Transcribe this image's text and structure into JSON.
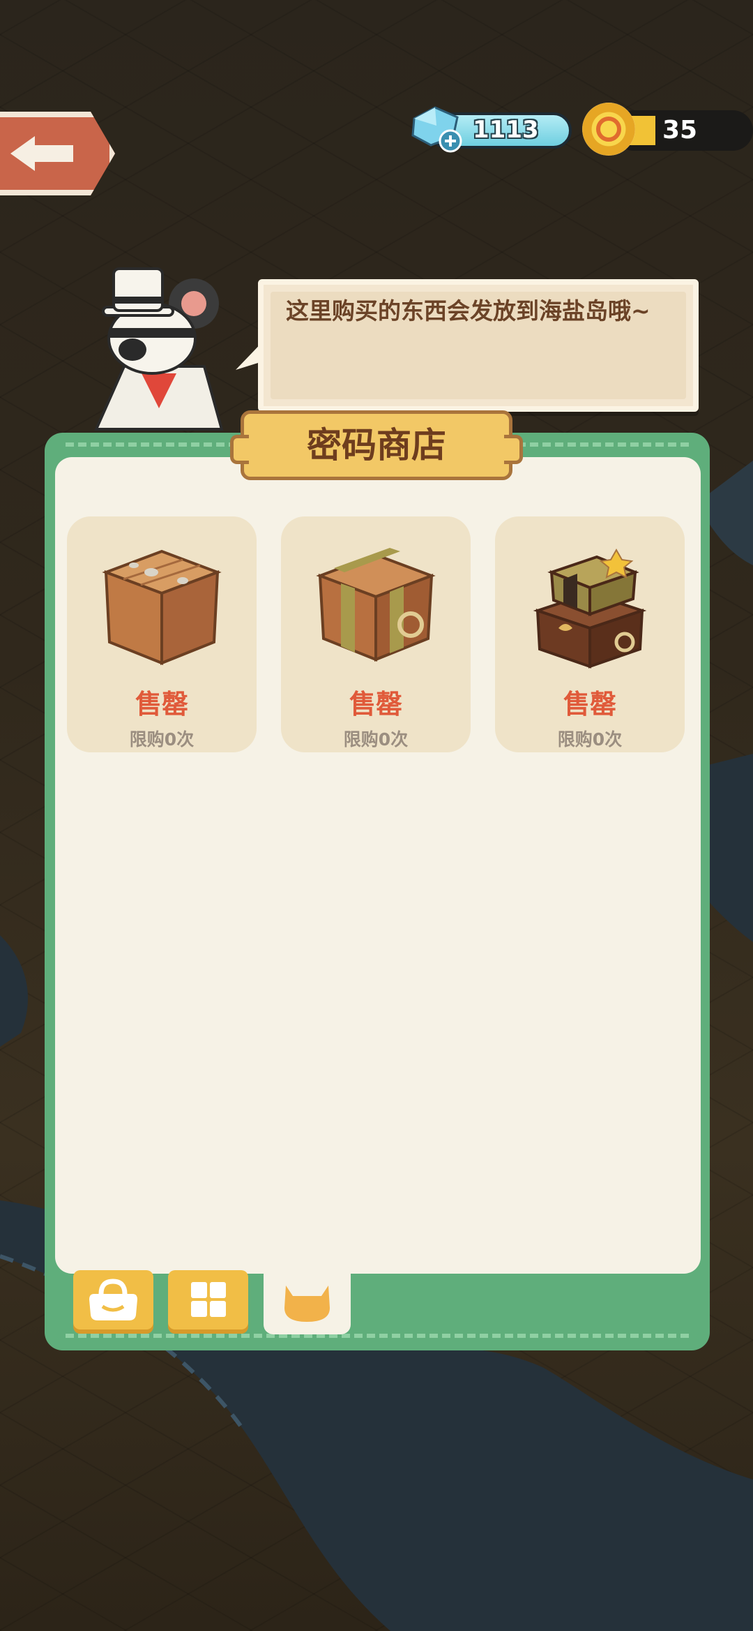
{
  "currency": {
    "gems": "1113",
    "coins": "35"
  },
  "npc": {
    "dialog": "这里购买的东西会发放到海盐岛哦~"
  },
  "shop": {
    "title": "密码商店",
    "items": [
      {
        "icon": "wooden-crate-icon",
        "status": "售罄",
        "limit": "限购0次"
      },
      {
        "icon": "strapped-crate-icon",
        "status": "售罄",
        "limit": "限购0次"
      },
      {
        "icon": "treasure-chest-icon",
        "status": "售罄",
        "limit": "限购0次"
      }
    ]
  },
  "tabs": [
    {
      "icon": "bag-icon",
      "active": false
    },
    {
      "icon": "grid-icon",
      "active": false
    },
    {
      "icon": "cat-icon",
      "active": true
    }
  ],
  "colors": {
    "panel_green": "#5fae7b",
    "panel_cream": "#f6f2e6",
    "sold_out_red": "#e05a3a",
    "title_plate": "#f2c866",
    "back_button": "#c9654a"
  }
}
